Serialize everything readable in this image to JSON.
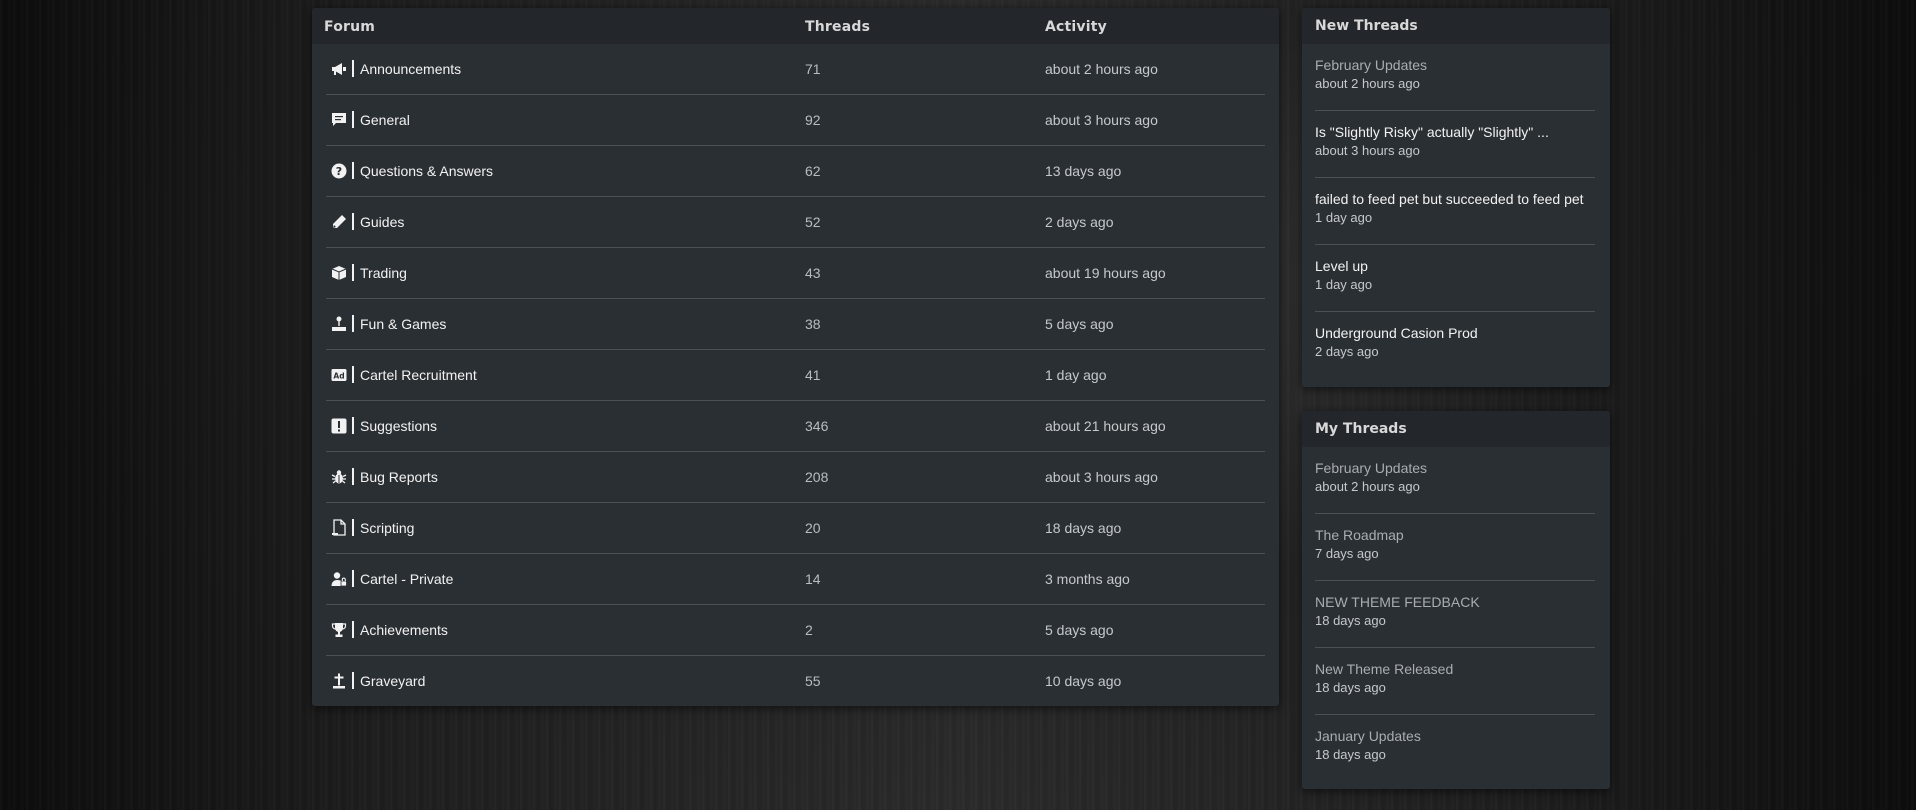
{
  "forum_table": {
    "headers": {
      "forum": "Forum",
      "threads": "Threads",
      "activity": "Activity"
    },
    "rows": [
      {
        "name": "Announcements",
        "threads": "71",
        "activity": "about 2 hours ago",
        "icon": "megaphone-icon"
      },
      {
        "name": "General",
        "threads": "92",
        "activity": "about 3 hours ago",
        "icon": "chat-bubble-icon"
      },
      {
        "name": "Questions & Answers",
        "threads": "62",
        "activity": "13 days ago",
        "icon": "question-circle-icon"
      },
      {
        "name": "Guides",
        "threads": "52",
        "activity": "2 days ago",
        "icon": "pencil-icon"
      },
      {
        "name": "Trading",
        "threads": "43",
        "activity": "about 19 hours ago",
        "icon": "box-icon"
      },
      {
        "name": "Fun & Games",
        "threads": "38",
        "activity": "5 days ago",
        "icon": "joystick-icon"
      },
      {
        "name": "Cartel Recruitment",
        "threads": "41",
        "activity": "1 day ago",
        "icon": "ad-icon"
      },
      {
        "name": "Suggestions",
        "threads": "346",
        "activity": "about 21 hours ago",
        "icon": "exclamation-square-icon"
      },
      {
        "name": "Bug Reports",
        "threads": "208",
        "activity": "about 3 hours ago",
        "icon": "bug-icon"
      },
      {
        "name": "Scripting",
        "threads": "20",
        "activity": "18 days ago",
        "icon": "script-file-icon"
      },
      {
        "name": "Cartel - Private",
        "threads": "14",
        "activity": "3 months ago",
        "icon": "user-lock-icon"
      },
      {
        "name": "Achievements",
        "threads": "2",
        "activity": "5 days ago",
        "icon": "trophy-icon"
      },
      {
        "name": "Graveyard",
        "threads": "55",
        "activity": "10 days ago",
        "icon": "grave-cross-icon"
      }
    ]
  },
  "new_threads": {
    "title": "New Threads",
    "items": [
      {
        "title": "February Updates",
        "time": "about 2 hours ago",
        "style": "muted"
      },
      {
        "title": "Is \"Slightly Risky\" actually \"Slightly\" ...",
        "time": "about 3 hours ago",
        "style": "bright"
      },
      {
        "title": "failed to feed pet but succeeded to feed pet",
        "time": "1 day ago",
        "style": "bright"
      },
      {
        "title": "Level up",
        "time": "1 day ago",
        "style": "bright"
      },
      {
        "title": "Underground Casion Prod",
        "time": "2 days ago",
        "style": "bright"
      }
    ]
  },
  "my_threads": {
    "title": "My Threads",
    "items": [
      {
        "title": "February Updates",
        "time": "about 2 hours ago",
        "style": "muted"
      },
      {
        "title": "The Roadmap",
        "time": "7 days ago",
        "style": "muted"
      },
      {
        "title": "NEW THEME FEEDBACK",
        "time": "18 days ago",
        "style": "muted"
      },
      {
        "title": "New Theme Released",
        "time": "18 days ago",
        "style": "muted"
      },
      {
        "title": "January Updates",
        "time": "18 days ago",
        "style": "muted"
      }
    ]
  },
  "colors": {
    "panel_bg": "#2a2f34",
    "header_bg": "#23272b",
    "divider": "#4a5056",
    "text_bright": "#f2f2f2",
    "text_muted": "#a9adb1"
  }
}
